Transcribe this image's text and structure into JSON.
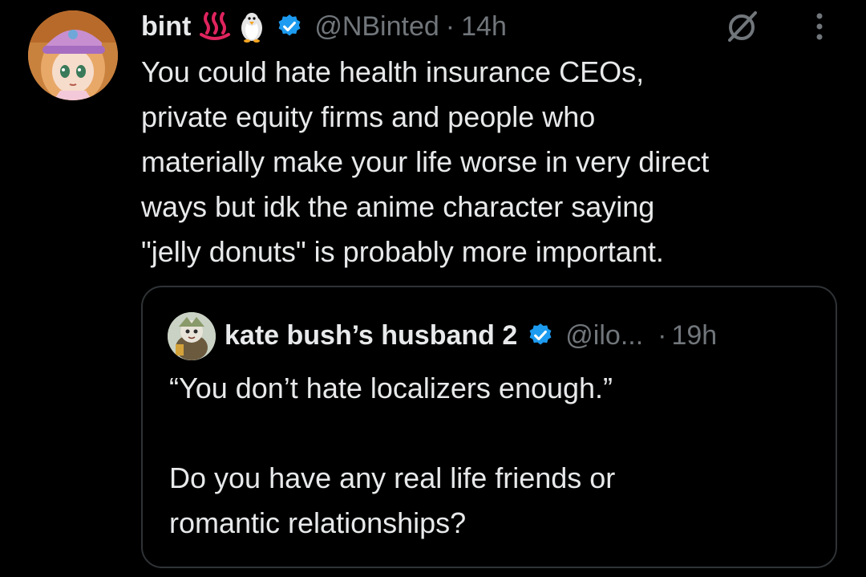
{
  "tweet": {
    "author": {
      "display_name": "bint",
      "emojis": [
        "hot-springs-emoji",
        "penguin-emoji"
      ],
      "verified": true,
      "handle": "@NBinted",
      "separator": "·",
      "timestamp": "14h",
      "avatar": "anime-girl-avatar"
    },
    "text_lines": [
      "You could hate health insurance CEOs,",
      "private equity firms and people who",
      "materially make your life worse in very direct",
      "ways but idk the anime character saying",
      "\"jelly donuts\" is probably more important."
    ],
    "icons": [
      "grok-icon",
      "more-icon"
    ]
  },
  "quoted_tweet": {
    "author": {
      "display_name": "kate bush’s husband 2",
      "verified": true,
      "handle": "@ilo...",
      "separator": "·",
      "timestamp": "19h",
      "avatar": "character-avatar"
    },
    "text_lines": [
      "“You don’t hate localizers enough.”",
      "",
      "Do you have any real life friends or",
      "romantic relationships?"
    ]
  },
  "colors": {
    "background": "#000000",
    "primary_text": "#e7e9ea",
    "secondary_text": "#71767b",
    "verified_blue": "#1d9bf0",
    "border": "#2f3336"
  }
}
